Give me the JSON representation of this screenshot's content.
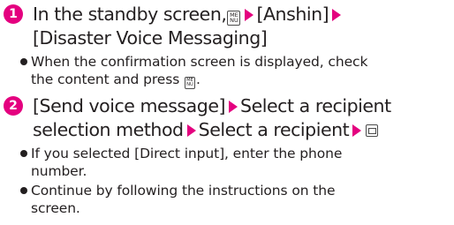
{
  "steps": [
    {
      "number": "1",
      "line1_part1": "In the standby screen,",
      "key_label_top": "ME",
      "key_label_bottom": "NU",
      "crumb1": "[Anshin]",
      "crumb2": "[Disaster Voice Messaging]",
      "notes": [
        {
          "line1": "When the confirmation screen is displayed, check",
          "line2": "the content and press"
        }
      ]
    },
    {
      "number": "2",
      "crumb1": "[Send voice message]",
      "crumb2": "Select a recipient",
      "crumb2b": "selection method",
      "crumb3": "Select a recipient",
      "end_icon": "mail-icon",
      "notes": [
        {
          "line1": "If you selected [Direct input], enter the phone",
          "line2": "number."
        },
        {
          "line1": "Continue by following the instructions on the",
          "line2": "screen."
        }
      ]
    }
  ],
  "colors": {
    "accent": "#e4007f",
    "text": "#231f20"
  }
}
